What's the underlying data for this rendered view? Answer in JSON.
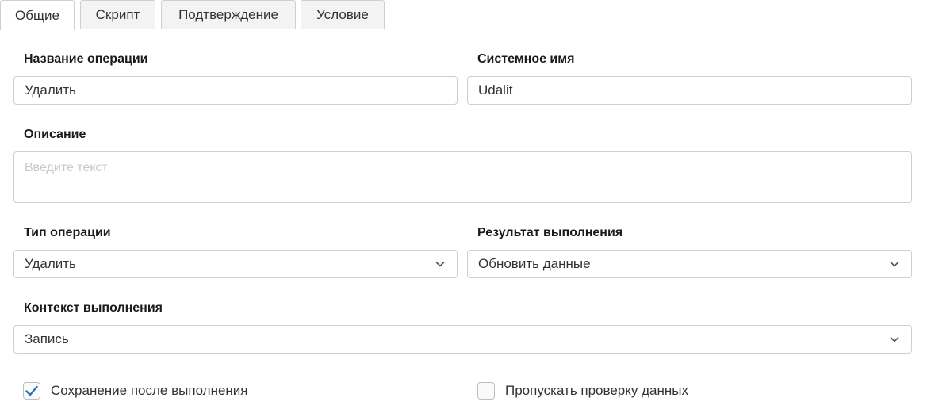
{
  "tabs": [
    {
      "label": "Общие",
      "active": true
    },
    {
      "label": "Скрипт",
      "active": false
    },
    {
      "label": "Подтверждение",
      "active": false
    },
    {
      "label": "Условие",
      "active": false
    }
  ],
  "form": {
    "operation_name": {
      "label": "Название операции",
      "value": "Удалить"
    },
    "system_name": {
      "label": "Системное имя",
      "value": "Udalit"
    },
    "description": {
      "label": "Описание",
      "value": "",
      "placeholder": "Введите текст"
    },
    "operation_type": {
      "label": "Тип операции",
      "value": "Удалить"
    },
    "execution_result": {
      "label": "Результат выполнения",
      "value": "Обновить данные"
    },
    "execution_context": {
      "label": "Контекст выполнения",
      "value": "Запись"
    },
    "save_after": {
      "label": "Сохранение после выполнения",
      "checked": true
    },
    "skip_validation": {
      "label": "Пропускать проверку данных",
      "checked": false
    }
  },
  "colors": {
    "check_accent": "#2f6fb3",
    "border": "#cfcfcf",
    "placeholder": "#c8c8c8"
  },
  "icons": {
    "select_arrow": "chevron-down-icon",
    "check": "checkmark-icon"
  }
}
